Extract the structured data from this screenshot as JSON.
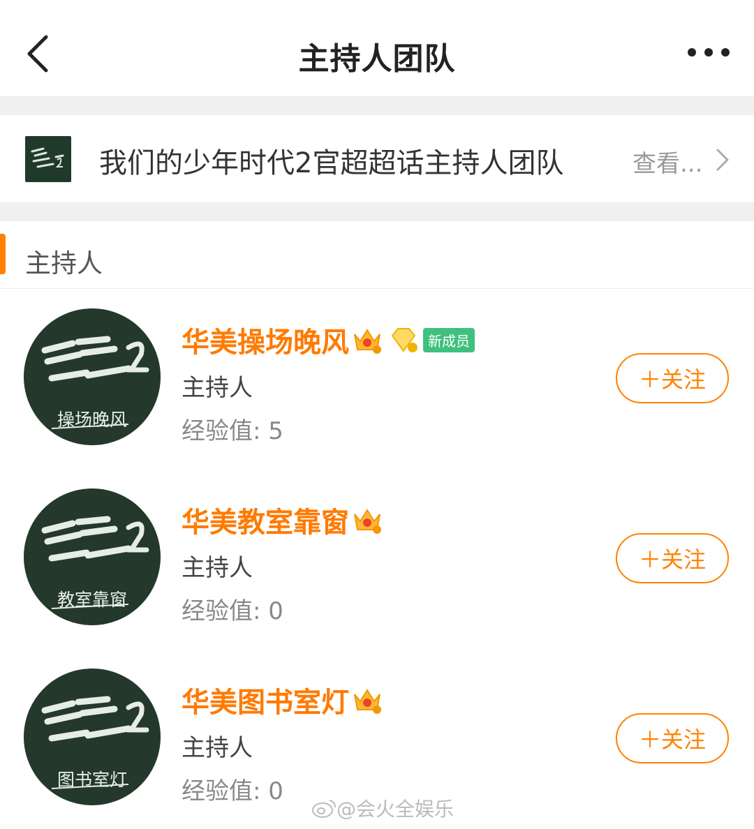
{
  "header": {
    "title": "主持人团队"
  },
  "topic": {
    "name": "我们的少年时代2官超超话主持人团队",
    "more_label": "查看..."
  },
  "section": {
    "title": "主持人"
  },
  "members": [
    {
      "name": "华美操场晚风",
      "role": "主持人",
      "exp": "经验值: 5",
      "avatar_caption": "操场晚风",
      "new_badge": "新成员",
      "follow_label": "＋关注"
    },
    {
      "name": "华美教室靠窗",
      "role": "主持人",
      "exp": "经验值: 0",
      "avatar_caption": "教室靠窗",
      "follow_label": "＋关注"
    },
    {
      "name": "华美图书室灯",
      "role": "主持人",
      "exp": "经验值: 0",
      "avatar_caption": "图书室灯",
      "follow_label": "＋关注"
    }
  ],
  "watermark": {
    "text": "@会火全娱乐"
  },
  "colors": {
    "accent": "#ff8200",
    "name": "#ff7a00",
    "new_badge": "#3fc07f",
    "avatar_bg": "#24382c"
  },
  "icons": [
    "back-icon",
    "more-icon",
    "chevron-right-icon",
    "crown-icon",
    "diamond-icon",
    "weibo-icon"
  ]
}
